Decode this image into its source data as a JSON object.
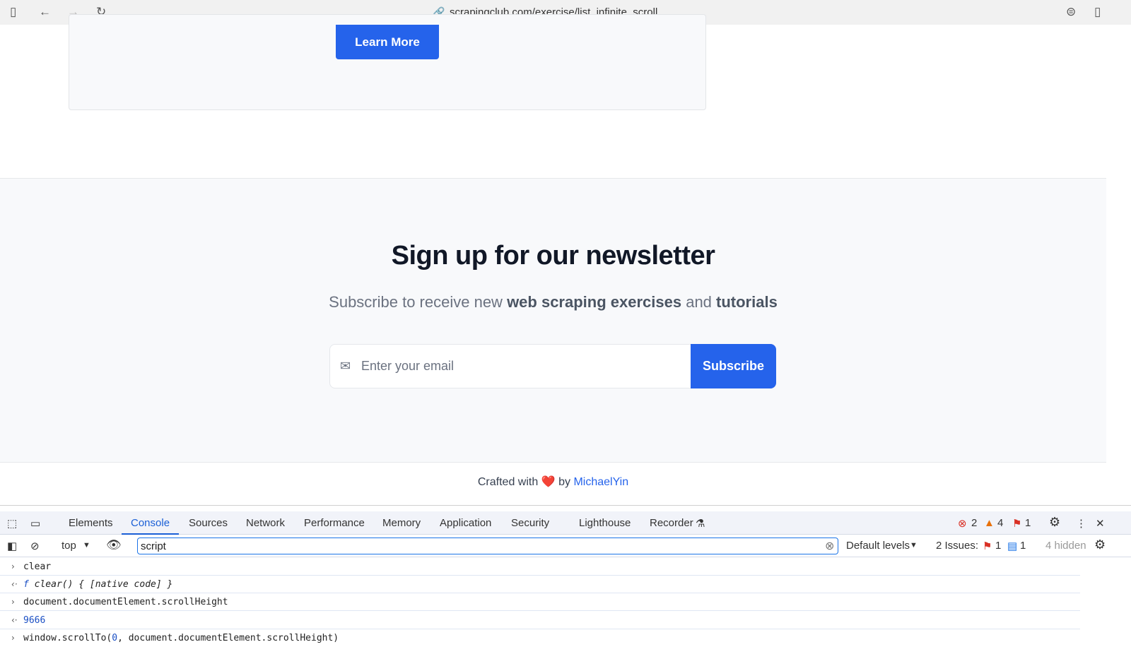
{
  "browser": {
    "url": "scrapingclub.com/exercise/list_infinite_scroll"
  },
  "card": {
    "button": "Learn More"
  },
  "newsletter": {
    "title": "Sign up for our newsletter",
    "subtitle_pre": "Subscribe to receive new ",
    "subtitle_b1": "web scraping exercises",
    "subtitle_mid": " and ",
    "subtitle_b2": "tutorials",
    "email_placeholder": "Enter your email",
    "subscribe": "Subscribe"
  },
  "footer": {
    "pre": "Crafted with",
    "heart": "❤️",
    "by": "by",
    "author": "MichaelYin"
  },
  "devtools": {
    "tabs": [
      "Elements",
      "Console",
      "Sources",
      "Network",
      "Performance",
      "Memory",
      "Application",
      "Security",
      "Lighthouse",
      "Recorder"
    ],
    "errors": "2",
    "warnings": "4",
    "messages": "1",
    "context": "top",
    "filter": "script",
    "levels": "Default levels",
    "issues_label": "2 Issues:",
    "issues_err": "1",
    "issues_info": "1",
    "hidden": "4 hidden",
    "console": [
      {
        "dir": "in",
        "text": "clear"
      },
      {
        "dir": "out",
        "prefix": "f",
        "text": " clear() { [native code] }"
      },
      {
        "dir": "in",
        "text": "document.documentElement.scrollHeight"
      },
      {
        "dir": "out",
        "text": "9666"
      },
      {
        "dir": "in",
        "pre": "window.scrollTo(",
        "num": "0",
        "post": ", document.documentElement.scrollHeight)"
      }
    ]
  }
}
